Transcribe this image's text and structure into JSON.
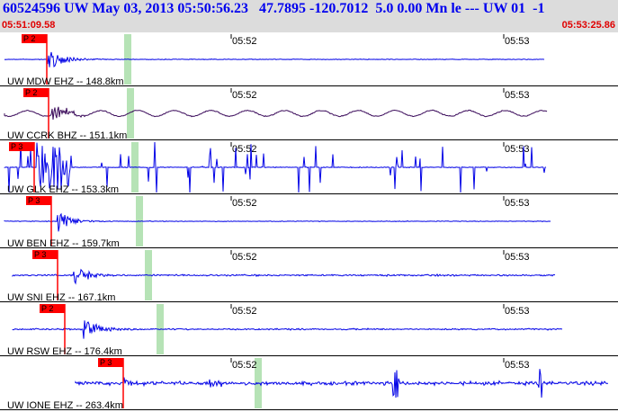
{
  "header": {
    "title": "60524596 UW May 03, 2013 05:50:56.23   47.7895 -120.7012  5.0 0.00 Mn le --- UW 01  -1",
    "start_time": "05:51:09.58",
    "end_time": "05:53:25.86"
  },
  "time_ticks": [
    "05:52",
    "05:53"
  ],
  "colors": {
    "trace_blue": "#0000e6",
    "trace_purple": "#3a0a5a",
    "pick_red": "#ff0000",
    "window_green": "#b6e3b6",
    "header_bg": "#dcdcdc",
    "title_blue": "#0000ee",
    "time_red": "#e00000"
  },
  "traces": [
    {
      "label": "UW MDW EHZ -- 148.8km",
      "pick": "P 2",
      "color": "blue",
      "amp": 0.6
    },
    {
      "label": "UW CCRK BHZ -- 151.1km",
      "pick": "P 2",
      "color": "purple",
      "amp": 0.5
    },
    {
      "label": "UW GLK EHZ -- 153.3km",
      "pick": "P 3",
      "color": "blue",
      "amp": 1.0
    },
    {
      "label": "UW BEN EHZ -- 159.7km",
      "pick": "P 3",
      "color": "blue",
      "amp": 0.6
    },
    {
      "label": "UW SNI EHZ -- 167.1km",
      "pick": "P 3",
      "color": "blue",
      "amp": 0.6
    },
    {
      "label": "UW RSW EHZ -- 176.4km",
      "pick": "P 2",
      "color": "blue",
      "amp": 0.6
    },
    {
      "label": "UW IONE EHZ -- 263.4km",
      "pick": "P 3",
      "color": "blue",
      "amp": 0.6
    }
  ]
}
